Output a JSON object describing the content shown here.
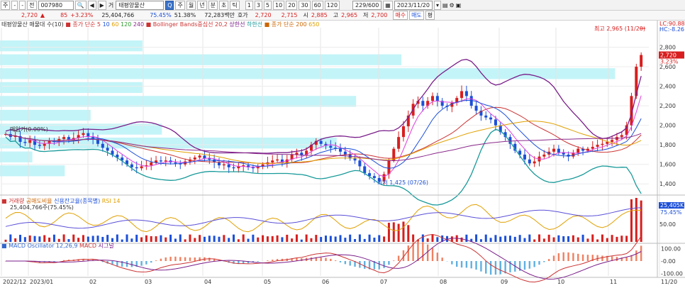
{
  "toolbar": {
    "buttons": [
      "주",
      "-",
      "-",
      "전"
    ],
    "code": "007980",
    "nav": [
      "◀",
      "▶"
    ],
    "type_label": "거",
    "name": "태평양물산",
    "periods": [
      "주",
      "월",
      "년",
      "분",
      "초",
      "틱"
    ],
    "period_selected": "Q",
    "minutes": [
      "1",
      "3",
      "5",
      "10",
      "20",
      "30",
      "60",
      "120"
    ],
    "count": "229/600",
    "date": "2023/11/20"
  },
  "quote": {
    "price": "2,720",
    "price_arrow": "▲",
    "change": "85",
    "change_pct": "+3.23%",
    "volume": "25,404,766",
    "vol_pct": "75.45%",
    "turnover": "51.38%",
    "amount": "72,283백만",
    "quote_label": "호가",
    "ask": "2,720",
    "bid": "2,715",
    "open_label": "시",
    "open": "2,885",
    "high_label": "고",
    "high": "2,965",
    "low_label": "저",
    "low": "2,700",
    "buy_btn": "매수",
    "sell_btn": "매도",
    "eval_btn": "평"
  },
  "legends": {
    "price": [
      {
        "text": "태평양물산 매물대 수(10)",
        "color": "#333333"
      },
      {
        "text": "■ 종가 단순 5",
        "color": "#cc3333"
      },
      {
        "text": "10",
        "color": "#1c4fd8"
      },
      {
        "text": "60",
        "color": "#e0a000"
      },
      {
        "text": "120",
        "color": "#2a9a2a"
      },
      {
        "text": "240",
        "color": "#8b2a8b"
      },
      {
        "text": "■ Bollinger Bands중심선 20,2",
        "color": "#cc3333"
      },
      {
        "text": "상한선",
        "color": "#7a1e8a"
      },
      {
        "text": "하한선",
        "color": "#1a9a9a"
      },
      {
        "text": "■ 종가 단순 200",
        "color": "#cc6600"
      },
      {
        "text": "650",
        "color": "#e0a000"
      }
    ],
    "volume": [
      {
        "text": "■ 거래량",
        "color": "#cc3333"
      },
      {
        "text": "공매도비율",
        "color": "#cc6600"
      },
      {
        "text": "신용잔고율(종목별)",
        "color": "#1c4fd8"
      },
      {
        "text": "RSI 14",
        "color": "#e0a000"
      }
    ],
    "volume_value": "25,404,766주(75.45%)",
    "macd": [
      {
        "text": "■ MACD Oscillator 12,26,9",
        "color": "#3366cc"
      },
      {
        "text": "MACD",
        "color": "#cc3333"
      },
      {
        "text": "시그널",
        "color": "#7a1e8a"
      }
    ]
  },
  "annotations": {
    "high": "최고 2,965 (11/20)",
    "low": "최저 1,425 (07/26)",
    "prev_close": "매입가(0.00%)",
    "lc": "LC:90.88",
    "hc": "HC:-8.26",
    "last_price_tag": "2,720",
    "last_pct_tag": "3.23%",
    "vol_tag": "25,405K",
    "vol_pct_tag": "75.45%"
  },
  "axes": {
    "price_ticks": [
      "2,800",
      "2,600",
      "2,400",
      "2,200",
      "2,000",
      "1,800",
      "1,600",
      "1,400"
    ],
    "volume_ticks": [
      "50.00"
    ],
    "macd_ticks": [
      "100.00",
      "-0.00",
      "-100.00"
    ],
    "x_labels": [
      "2022/12",
      "2023/01",
      "02",
      "03",
      "04",
      "05",
      "06",
      "07",
      "08",
      "09",
      "10",
      "11",
      "11/20"
    ]
  },
  "colors": {
    "up": "#d81e1e",
    "down": "#1c4fd8",
    "profile": "#bdf3f7",
    "bb_upper": "#7a1e8a",
    "bb_lower": "#1a9a9a",
    "bb_mid": "#cc3333",
    "ma5": "#cc3333",
    "ma10": "#1c4fd8",
    "ma60": "#e0a000",
    "ma120": "#2a9a2a",
    "ma240": "#8b2a8b",
    "rsi": "#e0a000",
    "credit": "#5a4fd8",
    "short": "#d05020"
  },
  "chart_data": {
    "type": "candlestick",
    "closes": [
      1910,
      1880,
      1890,
      1830,
      1820,
      1850,
      1800,
      1790,
      1810,
      1840,
      1830,
      1860,
      1880,
      1850,
      1870,
      1900,
      1920,
      1880,
      1860,
      1810,
      1770,
      1740,
      1700,
      1670,
      1640,
      1600,
      1570,
      1560,
      1580,
      1590,
      1620,
      1640,
      1630,
      1640,
      1620,
      1610,
      1600,
      1630,
      1650,
      1670,
      1690,
      1660,
      1650,
      1620,
      1590,
      1600,
      1570,
      1560,
      1580,
      1590,
      1570,
      1560,
      1580,
      1600,
      1620,
      1640,
      1650,
      1620,
      1650,
      1700,
      1720,
      1690,
      1740,
      1800,
      1840,
      1810,
      1790,
      1770,
      1760,
      1730,
      1700,
      1660,
      1640,
      1580,
      1510,
      1480,
      1460,
      1425,
      1500,
      1640,
      1760,
      1880,
      1990,
      2100,
      2220,
      2250,
      2200,
      2250,
      2300,
      2250,
      2200,
      2190,
      2230,
      2280,
      2350,
      2300,
      2200,
      2150,
      2100,
      2080,
      2060,
      2000,
      1930,
      1880,
      1810,
      1740,
      1700,
      1650,
      1610,
      1630,
      1680,
      1700,
      1730,
      1760,
      1720,
      1700,
      1680,
      1720,
      1760,
      1740,
      1760,
      1780,
      1800,
      1810,
      1830,
      1850,
      1880,
      1900,
      2000,
      2300,
      2600,
      2720
    ],
    "highlight_high": 2965,
    "highlight_low": 1425,
    "volume_profile": [
      0.0,
      0.1,
      0.05,
      0.52,
      0.25,
      0.14,
      0.55,
      0.22,
      0.95,
      0.62,
      0.22
    ],
    "x_labels": [
      "2022/12",
      "2023/01",
      "02",
      "03",
      "04",
      "05",
      "06",
      "07",
      "08",
      "09",
      "10",
      "11"
    ]
  }
}
